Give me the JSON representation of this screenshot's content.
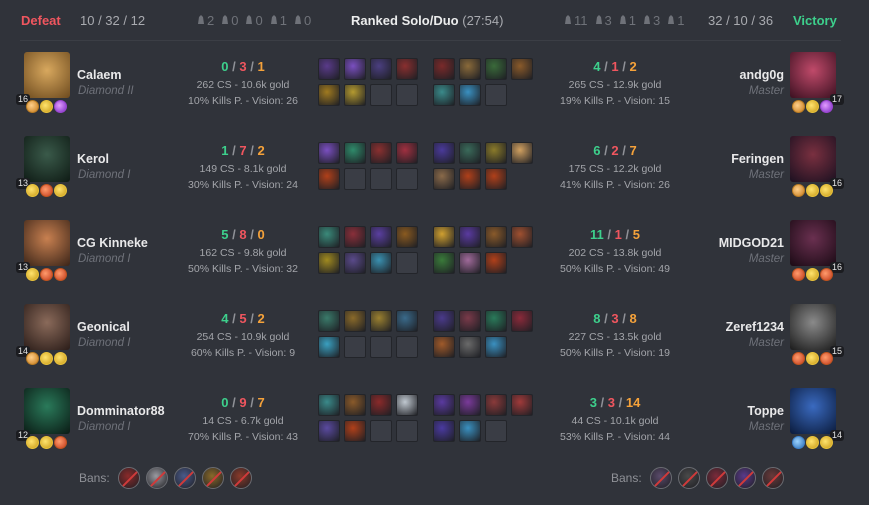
{
  "header": {
    "left_result": "Defeat",
    "left_kda": "10 / 32 / 12",
    "left_objectives": [
      "2",
      "0",
      "0",
      "1",
      "0"
    ],
    "title": "Ranked Solo/Duo",
    "duration": "(27:54)",
    "right_objectives": [
      "11",
      "3",
      "1",
      "3",
      "1"
    ],
    "right_kda": "32 / 10 / 36",
    "right_result": "Victory"
  },
  "blue_team": [
    {
      "name": "Calaem",
      "rank": "Diamond II",
      "level": "16",
      "kills": "0",
      "deaths": "3",
      "assists": "1",
      "cs_gold": "262 CS - 10.6k gold",
      "kp_vision": "10% Kills P. - Vision: 26",
      "portrait": [
        "#d8a85e",
        "#6d4a1e"
      ],
      "runes": [
        "o",
        "g",
        "p"
      ],
      "items": [
        "#5a3b8a",
        "#7a4fc0",
        "#4b3f80",
        "#8a2f2f",
        "#a07a20",
        "#b49a30",
        "",
        ""
      ]
    },
    {
      "name": "Kerol",
      "rank": "Diamond I",
      "level": "13",
      "kills": "1",
      "deaths": "7",
      "assists": "2",
      "cs_gold": "149 CS - 8.1k gold",
      "kp_vision": "30% Kills P. - Vision: 24",
      "portrait": [
        "#3a5a4a",
        "#0e1a14"
      ],
      "runes": [
        "g",
        "r",
        "g"
      ],
      "items": [
        "#7a4fc0",
        "#2f8a6a",
        "#8a3030",
        "#a03040",
        "#b0401a",
        "",
        "",
        ""
      ]
    },
    {
      "name": "CG Kinneke",
      "rank": "Diamond I",
      "level": "13",
      "kills": "5",
      "deaths": "8",
      "assists": "0",
      "cs_gold": "162 CS - 9.8k gold",
      "kp_vision": "50% Kills P. - Vision: 32",
      "portrait": [
        "#c88050",
        "#3a2418"
      ],
      "runes": [
        "g",
        "r",
        "r"
      ],
      "items": [
        "#3a8a7a",
        "#8a2f3a",
        "#5a3fa0",
        "#8a5a20",
        "#a08a20",
        "#5a4a8a",
        "#3a90b0",
        ""
      ]
    },
    {
      "name": "Geonical",
      "rank": "Diamond I",
      "level": "14",
      "kills": "4",
      "deaths": "5",
      "assists": "2",
      "cs_gold": "254 CS - 10.9k gold",
      "kp_vision": "60% Kills P. - Vision: 9",
      "portrait": [
        "#8a6a5a",
        "#2a1c18"
      ],
      "runes": [
        "o",
        "g",
        "g"
      ],
      "items": [
        "#3a7a6a",
        "#8a6a2a",
        "#9a8030",
        "#3a6a8a",
        "#3aa0c0",
        "",
        "",
        ""
      ]
    },
    {
      "name": "Domminator88",
      "rank": "Diamond I",
      "level": "12",
      "kills": "0",
      "deaths": "9",
      "assists": "7",
      "cs_gold": "14 CS - 6.7k gold",
      "kp_vision": "70% Kills P. - Vision: 43",
      "portrait": [
        "#2a7a5a",
        "#0a1a14"
      ],
      "runes": [
        "g",
        "g",
        "r"
      ],
      "items": [
        "#3a8a8a",
        "#8a5a2a",
        "#8a2a2a",
        "#c0c8d0",
        "#5a4aa0",
        "#b0401a",
        "",
        ""
      ]
    }
  ],
  "blue_items2": [
    [
      "#7a2a2a",
      "#8a6a3a",
      "#3a6a3a",
      "#8a5a2a",
      "#3a8a8a",
      "#3a90c0",
      ""
    ],
    [
      "#4a3a9a",
      "#3a6a5a",
      "#8a7a2a",
      "#d0a060",
      "#8a6a4a",
      "#b0401a",
      "#b0401a"
    ],
    [
      "#d0a030",
      "#5a3aa0",
      "#8a5a2a",
      "#a05030",
      "#3a7a3a",
      "#a06a9a",
      "#b0401a"
    ],
    [
      "#4a3a8a",
      "#7a3a4a",
      "#2a7a5a",
      "#8a2a3a",
      "#a05a2a",
      "#6a6a6a",
      "#3a90c0"
    ],
    [
      "#5a3aa0",
      "#7a3a9a",
      "#8a3a3a",
      "#a03a3a",
      "#4a3aa0",
      "#3a90c0",
      ""
    ]
  ],
  "red_team": [
    {
      "name": "andg0g",
      "rank": "Master",
      "level": "17",
      "kills": "4",
      "deaths": "1",
      "assists": "2",
      "cs_gold": "265 CS - 12.9k gold",
      "kp_vision": "19% Kills P. - Vision: 15",
      "portrait": [
        "#c04a6a",
        "#3a1020"
      ],
      "runes": [
        "o",
        "g",
        "p"
      ]
    },
    {
      "name": "Feringen",
      "rank": "Master",
      "level": "16",
      "kills": "6",
      "deaths": "2",
      "assists": "7",
      "cs_gold": "175 CS - 12.2k gold",
      "kp_vision": "41% Kills P. - Vision: 26",
      "portrait": [
        "#7a3040",
        "#1a1020"
      ],
      "runes": [
        "o",
        "g",
        "g"
      ]
    },
    {
      "name": "MIDGOD21",
      "rank": "Master",
      "level": "16",
      "kills": "11",
      "deaths": "1",
      "assists": "5",
      "cs_gold": "202 CS - 13.8k gold",
      "kp_vision": "50% Kills P. - Vision: 49",
      "portrait": [
        "#6a3050",
        "#1a0a14"
      ],
      "runes": [
        "r",
        "g",
        "r"
      ]
    },
    {
      "name": "Zeref1234",
      "rank": "Master",
      "level": "15",
      "kills": "8",
      "deaths": "3",
      "assists": "8",
      "cs_gold": "227 CS - 13.5k gold",
      "kp_vision": "50% Kills P. - Vision: 19",
      "portrait": [
        "#8a8a8a",
        "#1a1a1a"
      ],
      "runes": [
        "r",
        "g",
        "r"
      ]
    },
    {
      "name": "Toppe",
      "rank": "Master",
      "level": "14",
      "kills": "3",
      "deaths": "3",
      "assists": "14",
      "cs_gold": "44 CS - 10.1k gold",
      "kp_vision": "53% Kills P. - Vision: 44",
      "portrait": [
        "#3a6ac0",
        "#0a1a3a"
      ],
      "runes": [
        "b",
        "g",
        "g"
      ]
    }
  ],
  "bans": {
    "label": "Bans:",
    "left": [
      "#8a2a2a",
      "#9a9aa0",
      "#4a5a8a",
      "#8a6a2a",
      "#8a3a2a"
    ],
    "right": [
      "#5a4a6a",
      "#4a4a4a",
      "#7a2a3a",
      "#5a3a8a",
      "#6a3a3a"
    ]
  }
}
